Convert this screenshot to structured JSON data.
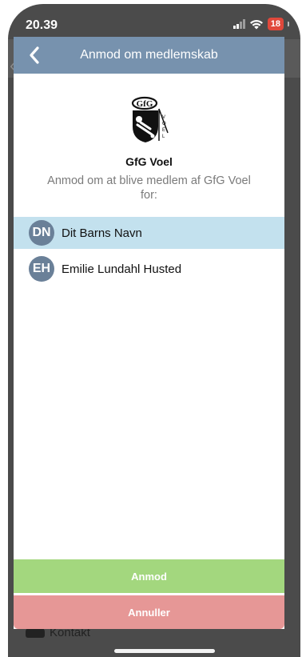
{
  "status_bar": {
    "time": "20.39",
    "battery": "18"
  },
  "background": {
    "contact_label": "Kontakt"
  },
  "modal": {
    "title": "Anmod om medlemskab",
    "club_name": "GfG Voel",
    "request_text": "Anmod om at blive medlem af GfG Voel for:",
    "members": [
      {
        "initials": "DN",
        "name": "Dit Barns Navn",
        "selected": true
      },
      {
        "initials": "EH",
        "name": "Emilie Lundahl Husted",
        "selected": false
      }
    ],
    "request_button": "Anmod",
    "cancel_button": "Annuller"
  },
  "colors": {
    "header": "#7792ae",
    "selected_row": "#c3e1ee",
    "avatar": "#6a8098",
    "request_button": "#a3d77e",
    "cancel_button": "#e69796",
    "battery": "#e0483b"
  }
}
